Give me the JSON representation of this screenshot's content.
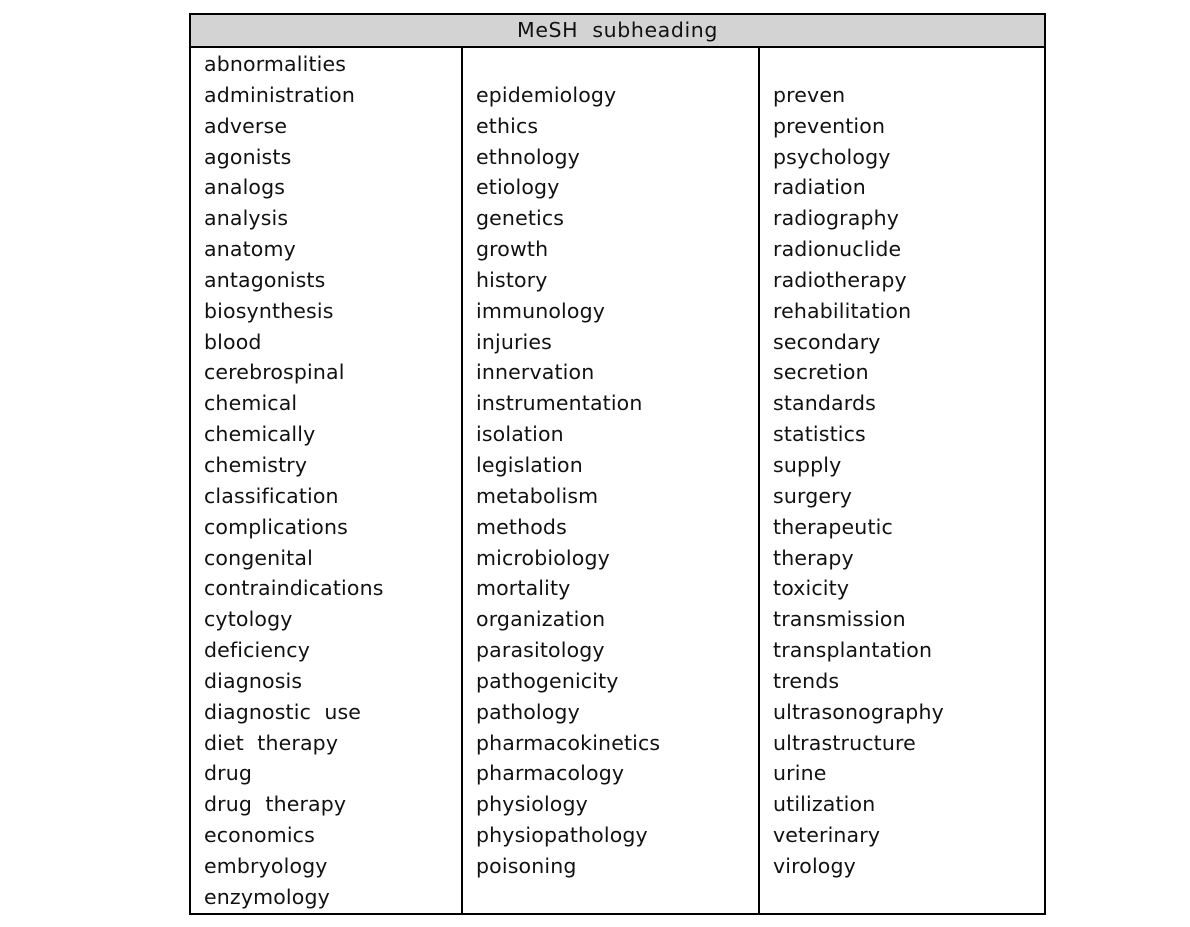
{
  "table": {
    "header": {
      "title": "MeSH  subheading"
    },
    "columns": [
      {
        "name": "column-1",
        "leading_blank_rows": 0,
        "items": [
          "abnormalities",
          "administration",
          "adverse",
          "agonists",
          "analogs",
          "analysis",
          "anatomy",
          "antagonists",
          "biosynthesis",
          "blood",
          "cerebrospinal",
          "chemical",
          "chemically",
          "chemistry",
          "classification",
          "complications",
          "congenital",
          "contraindications",
          "cytology",
          "deficiency",
          "diagnosis",
          "diagnostic  use",
          "diet  therapy",
          "drug",
          "drug  therapy",
          "economics",
          "embryology",
          "enzymology"
        ]
      },
      {
        "name": "column-2",
        "leading_blank_rows": 1,
        "items": [
          "epidemiology",
          "ethics",
          "ethnology",
          "etiology",
          "genetics",
          "growth",
          "history",
          "immunology",
          "injuries",
          "innervation",
          "instrumentation",
          "isolation",
          "legislation",
          "metabolism",
          "methods",
          "microbiology",
          "mortality",
          "organization",
          "parasitology",
          "pathogenicity",
          "pathology",
          "pharmacokinetics",
          "pharmacology",
          "physiology",
          "physiopathology",
          "poisoning"
        ]
      },
      {
        "name": "column-3",
        "leading_blank_rows": 1,
        "items": [
          "preven",
          "prevention",
          "psychology",
          "radiation",
          "radiography",
          "radionuclide",
          "radiotherapy",
          "rehabilitation",
          "secondary",
          "secretion",
          "standards",
          "statistics",
          "supply",
          "surgery",
          "therapeutic",
          "therapy",
          "toxicity",
          "transmission",
          "transplantation",
          "trends",
          "ultrasonography",
          "ultrastructure",
          "urine",
          "utilization",
          "veterinary",
          "virology"
        ]
      }
    ]
  },
  "colors": {
    "header_background": "#d3d3d3",
    "border": "#000000",
    "text": "#111111",
    "page_background": "#ffffff"
  }
}
